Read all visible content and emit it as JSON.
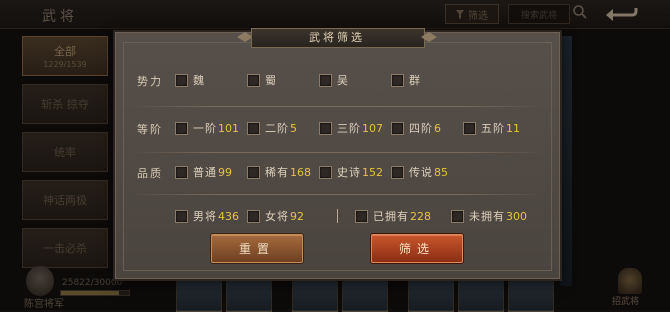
{
  "background": {
    "title": "武将",
    "filter_button_label": "筛选",
    "search_placeholder": "搜索武将",
    "categories": [
      {
        "label": "全部",
        "sub": "1229/1539"
      },
      {
        "label": "斩杀 掠夺"
      },
      {
        "label": "统率"
      },
      {
        "label": "神话两极"
      },
      {
        "label": "一击必杀"
      }
    ],
    "exp_text": "25822/30000",
    "exp_progress": 0.86,
    "bottom_left_label": "陈宫将军",
    "bottom_right_label": "招武将"
  },
  "modal": {
    "title": "武将筛选",
    "faction": {
      "label": "势力",
      "options": [
        {
          "label": "魏"
        },
        {
          "label": "蜀"
        },
        {
          "label": "吴"
        },
        {
          "label": "群"
        }
      ]
    },
    "rank": {
      "label": "等阶",
      "options": [
        {
          "label": "一阶",
          "count": "101"
        },
        {
          "label": "二阶",
          "count": "5"
        },
        {
          "label": "三阶",
          "count": "107"
        },
        {
          "label": "四阶",
          "count": "6"
        },
        {
          "label": "五阶",
          "count": "11"
        }
      ]
    },
    "quality": {
      "label": "品质",
      "options": [
        {
          "label": "普通",
          "count": "99"
        },
        {
          "label": "稀有",
          "count": "168"
        },
        {
          "label": "史诗",
          "count": "152"
        },
        {
          "label": "传说",
          "count": "85"
        }
      ]
    },
    "gender": {
      "options": [
        {
          "label": "男将",
          "count": "436"
        },
        {
          "label": "女将",
          "count": "92"
        }
      ]
    },
    "ownership": {
      "options": [
        {
          "label": "已拥有",
          "count": "228"
        },
        {
          "label": "未拥有",
          "count": "300"
        }
      ]
    },
    "reset_label": "重置",
    "confirm_label": "筛选"
  },
  "colors": {
    "count_yellow": "#e8c23e",
    "reset_button": "#8c5530",
    "confirm_button": "#b0431f"
  }
}
